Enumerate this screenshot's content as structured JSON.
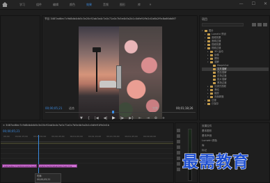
{
  "header": {
    "tabs": [
      "学习",
      "组件",
      "编辑",
      "颜色",
      "效果",
      "音频",
      "图形",
      "库"
    ],
    "active_tab": 4,
    "more": "»"
  },
  "window": {
    "minimize": "—",
    "maximize": "☐",
    "close": "✕"
  },
  "program": {
    "title": "节目 3487ad6ec7c9d8db4db5c3e20c92ab3a4c7a0c71a0c7b5e4b5a2b1c0dfe91ffe2d1b6b2f9c8a66db8f7",
    "timecode_left": "00;00;05;21",
    "fit_label": "适合",
    "zoom_label": "完整",
    "timecode_right": "00;01;18;26"
  },
  "transport": [
    "▼",
    "{",
    "|◀",
    "◀|",
    "▶",
    "|▶",
    "▶}",
    "⇤",
    "⇥",
    "⊕",
    "+"
  ],
  "project": {
    "title": "项目",
    "tree": [
      {
        "label": "图片",
        "level": 0,
        "open": true
      },
      {
        "label": "Lumetri 预设",
        "level": 1
      },
      {
        "label": "音频效果",
        "level": 1
      },
      {
        "label": "音频过渡",
        "level": 1
      },
      {
        "label": "视频效果",
        "level": 1
      },
      {
        "label": "视频过渡",
        "level": 1,
        "open": true
      },
      {
        "label": "3D 运动",
        "level": 2
      },
      {
        "label": "划像",
        "level": 2
      },
      {
        "label": "擦除",
        "level": 2
      },
      {
        "label": "溶解",
        "level": 2,
        "open": true
      },
      {
        "label": "MorphCut",
        "level": 3
      },
      {
        "label": "交叉溶解",
        "level": 3,
        "selected": true
      },
      {
        "label": "叠加溶解",
        "level": 3
      },
      {
        "label": "白场过渡",
        "level": 3
      },
      {
        "label": "胶片溶解",
        "level": 3
      },
      {
        "label": "黑场过渡",
        "level": 3
      },
      {
        "label": "沉浸式视频",
        "level": 2
      },
      {
        "label": "滑动",
        "level": 2
      },
      {
        "label": "缩放",
        "level": 2
      },
      {
        "label": "页面剥落",
        "level": 2
      },
      {
        "label": "过渡",
        "level": 1
      },
      {
        "label": "已保存",
        "level": 1
      }
    ]
  },
  "timeline": {
    "sequence": "× 3487ad6ec7c9d8db4db5c3e20c92ab3a4c7a0c71a0c7b5e4b5a2b1c0dfe91ffe2d1b",
    "timecode": "00;00;05;21",
    "ruler": [
      "00;00",
      "00;00;15;00",
      "00;00;30;00",
      "00;00;45;00",
      "00;01;00;00",
      "00;01;15;00",
      "00;01;30;00",
      "00;01;45;00",
      "00;02;00;00"
    ],
    "clip1": "3487ad6ec7c9d8db4db5c3e20c",
    "clip2": "b4b5c3e20c92ab3a4c7a0c71a",
    "tooltip_line1": "时间:",
    "tooltip_line2": "00;00;05;21"
  },
  "effects": {
    "rows": [
      "效果控件",
      "基本图形",
      "基本声音",
      "Lumetri 颜色",
      "库",
      "标记",
      "历史记录"
    ]
  },
  "watermark": "最需教育",
  "colors": {
    "accent": "#3b8be0",
    "clip": "#d272d6",
    "watermark": "#1f4fcf"
  }
}
